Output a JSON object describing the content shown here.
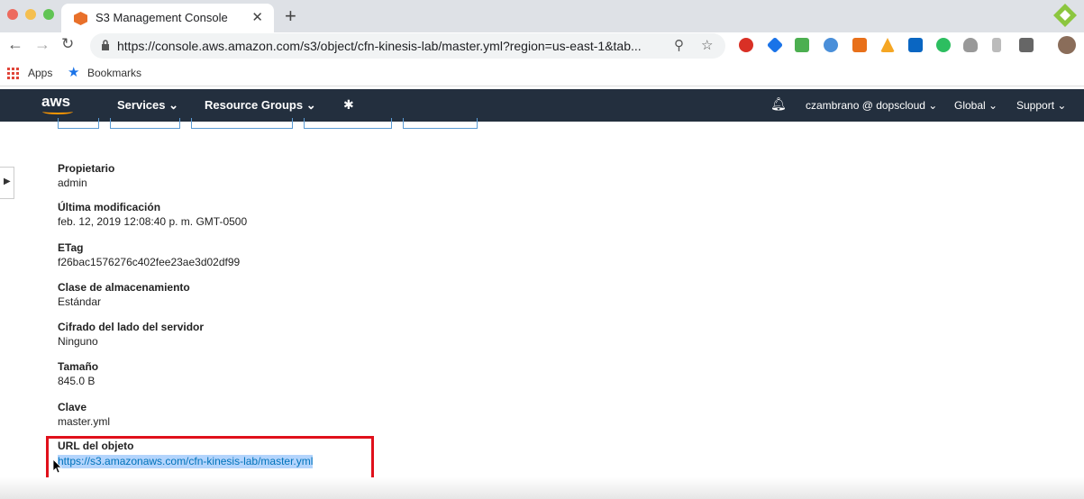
{
  "browser": {
    "tab_title": "S3 Management Console",
    "tab_close": "✕",
    "new_tab": "+",
    "url": "https://console.aws.amazon.com/s3/object/cfn-kinesis-lab/master.yml?region=us-east-1&tab...",
    "bookmarks": [
      {
        "label": "Apps"
      },
      {
        "label": "Bookmarks"
      }
    ]
  },
  "aws_nav": {
    "logo": "aws",
    "services": "Services ⌄",
    "resource_groups": "Resource Groups ⌄",
    "user": "czambrano @ dopscloud ⌄",
    "region": "Global ⌄",
    "support": "Support ⌄"
  },
  "properties": [
    {
      "label": "Propietario",
      "value": "admin"
    },
    {
      "label": "Última modificación",
      "value": "feb. 12, 2019 12:08:40 p. m. GMT-0500"
    },
    {
      "label": "ETag",
      "value": "f26bac1576276c402fee23ae3d02df99"
    },
    {
      "label": "Clase de almacenamiento",
      "value": "Estándar"
    },
    {
      "label": "Cifrado del lado del servidor",
      "value": "Ninguno"
    },
    {
      "label": "Tamaño",
      "value": "845.0 B"
    },
    {
      "label": "Clave",
      "value": "master.yml"
    }
  ],
  "object_url": {
    "label": "URL del objeto",
    "value": "https://s3.amazonaws.com/cfn-kinesis-lab/master.yml"
  },
  "colors": {
    "aws_nav_bg": "#232f3e",
    "highlight_border": "#e0101b",
    "link": "#0073bb",
    "selection": "#b3d4fc"
  }
}
